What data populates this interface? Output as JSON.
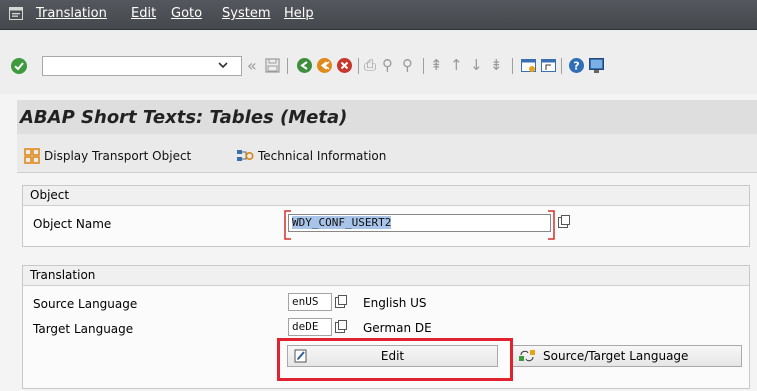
{
  "menubar": {
    "items": [
      "Translation",
      "Edit",
      "Goto",
      "System",
      "Help"
    ]
  },
  "toolbar": {
    "command_field_value": "",
    "icons": [
      "ok-icon",
      "dropdown-icon",
      "back-nav-icon",
      "save-icon",
      "back-icon",
      "exit-icon",
      "cancel-icon",
      "print-icon",
      "find-icon",
      "find-next-icon",
      "first-page-icon",
      "previous-page-icon",
      "next-page-icon",
      "last-page-icon",
      "create-session-icon",
      "shortcut-icon",
      "help-icon",
      "layout-icon"
    ]
  },
  "title": "ABAP Short Texts: Tables (Meta)",
  "app_toolbar": {
    "display_transport": "Display Transport Object",
    "technical_info": "Technical Information"
  },
  "object_group": {
    "header": "Object",
    "name_label": "Object Name",
    "name_value": "WDY_CONF_USERT2"
  },
  "translation_group": {
    "header": "Translation",
    "source_label": "Source Language",
    "source_value": "enUS",
    "source_desc": "English US",
    "target_label": "Target Language",
    "target_value": "deDE",
    "target_desc": "German DE",
    "edit_button": "Edit",
    "source_target_button": "Source/Target Language"
  },
  "colors": {
    "menubar": "#4b4f54",
    "highlight": "#e2232f",
    "selection": "#a8c4e8"
  }
}
